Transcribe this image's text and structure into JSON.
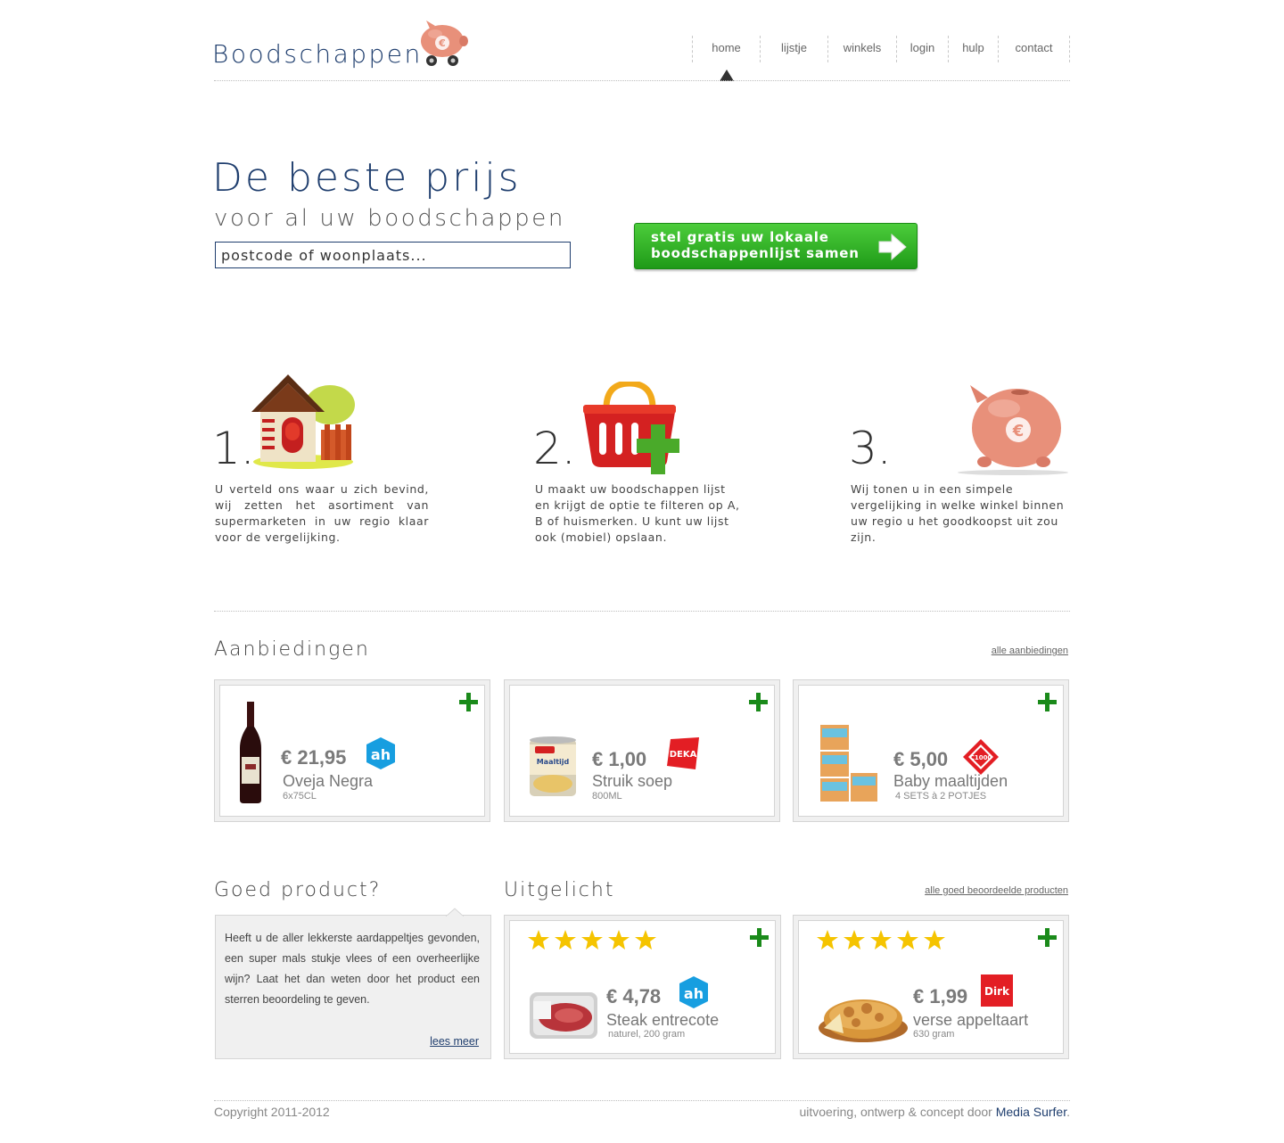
{
  "brand": {
    "logo_text": "Boodschappen"
  },
  "nav": {
    "items": [
      {
        "label": "home"
      },
      {
        "label": "lijstje"
      },
      {
        "label": "winkels"
      },
      {
        "label": "login"
      },
      {
        "label": "hulp"
      },
      {
        "label": "contact"
      }
    ],
    "active": "home"
  },
  "hero": {
    "title": "De beste prijs",
    "subtitle": "voor al uw boodschappen",
    "search_placeholder": "postcode of woonplaats...",
    "cta_line1": "stel gratis uw lokaale",
    "cta_line2": "boodschappenlijst samen"
  },
  "steps": [
    {
      "number": "1.",
      "icon": "house-icon",
      "text": "U verteld ons waar u zich bevind, wij zetten het asortiment van supermarketen in uw regio klaar voor de vergelijking."
    },
    {
      "number": "2.",
      "icon": "basket-plus-icon",
      "text": "U maakt uw boodschappen lijst en krijgt de optie te filteren op A, B of huismerken. U kunt uw lijst ook (mobiel) opslaan."
    },
    {
      "number": "3.",
      "icon": "piggy-bank-icon",
      "text": "Wij tonen u in een simpele vergelijking in welke winkel binnen uw regio u het goodkoopst uit zou zijn."
    }
  ],
  "offers": {
    "title": "Aanbiedingen",
    "link": "alle aanbiedingen",
    "items": [
      {
        "price": "€ 21,95",
        "name": "Oveja Negra",
        "detail": "6x75CL",
        "store": "ah-logo",
        "image": "wine-bottle-icon"
      },
      {
        "price": "€ 1,00",
        "name": "Struik soep",
        "detail": "800ML",
        "store": "deka-logo",
        "image": "soup-can-icon",
        "store_text": "DEKA"
      },
      {
        "price": "€ 5,00",
        "name": "Baby maaltijden",
        "detail": "4 SETS à 2 POTJES",
        "store": "c1000-logo",
        "image": "baby-meals-icon",
        "store_text": "C1000"
      }
    ]
  },
  "good_product": {
    "title": "Goed product?",
    "text": "Heeft u de aller lekkerste aardappeltjes gevonden, een super mals stukje vlees of een overheerlijke wijn? Laat het dan weten door het product een sterren beoordeling te geven.",
    "link": "lees meer"
  },
  "featured": {
    "title": "Uitgelicht",
    "link": "alle goed beoordeelde producten",
    "items": [
      {
        "price": "€ 4,78",
        "name": "Steak entrecote",
        "detail": "naturel, 200 gram",
        "store": "ah-logo",
        "image": "steak-package-icon",
        "rating": 5
      },
      {
        "price": "€ 1,99",
        "name": "verse appeltaart",
        "detail": "630 gram",
        "store": "dirk-logo",
        "image": "apple-pie-icon",
        "rating": 5,
        "store_text": "Dirk"
      }
    ]
  },
  "footer": {
    "copyright": "Copyright 2011-2012",
    "credit": "uitvoering, ontwerp & concept door ",
    "credit_link": "Media Surfer",
    "credit_end": "."
  },
  "colors": {
    "brand_blue": "#1f3e6e",
    "cta_green": "#2fb525",
    "plus_green": "#1a8a1a",
    "star_yellow": "#f5c400",
    "ah_blue": "#179ee0",
    "deka_red": "#e31e24"
  }
}
